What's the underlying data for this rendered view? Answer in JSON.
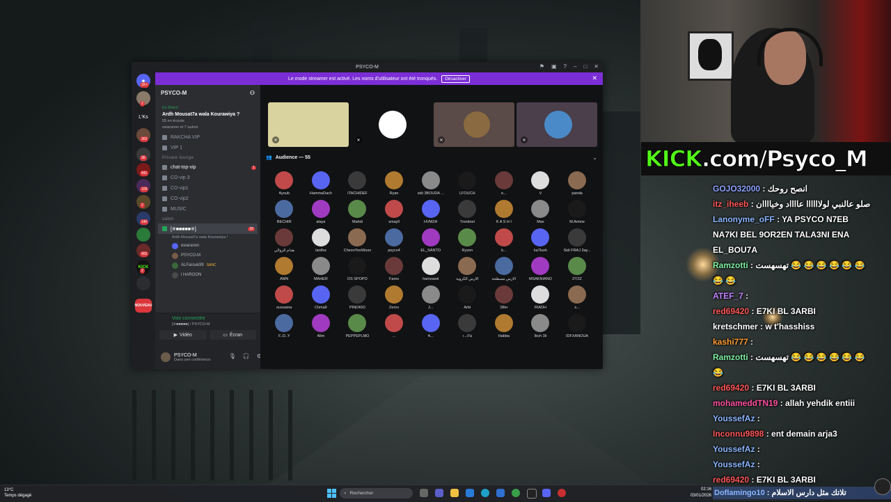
{
  "window": {
    "title": "PSYCO-M",
    "banner_text": "Le mode streamer est activé. Les noms d'utilisateur ont été tronqués.",
    "banner_button": "Désactiver"
  },
  "servers": {
    "lks_label": "L'Ks",
    "badges": [
      "1K+",
      "2",
      "362",
      "36",
      "441",
      "109",
      "2",
      "140",
      "403",
      "2"
    ],
    "kick_label": "KICK",
    "nouveau_label": "NOUVEAU"
  },
  "sidebar": {
    "server_name": "PSYCO-M",
    "live_tag": "En Direct",
    "live_title": "Ardh Mousat7a wala Kourawiya ?",
    "live_listen": "55 en écoute",
    "live_users": "ewaranon et 7 autres",
    "channels": [
      {
        "label": "RAKCHA VIP"
      },
      {
        "label": "VIP 1"
      }
    ],
    "cat_private": "Private lounge",
    "private_channels": [
      {
        "label": "chat-top-vip",
        "badge": "1"
      },
      {
        "label": "CO-vip 3"
      },
      {
        "label": "CO-vip1"
      },
      {
        "label": "CO-vip2"
      },
      {
        "label": "MUSIC"
      }
    ],
    "cat_salon": "salon",
    "active_stage": {
      "label": "[※■■■■■※]",
      "sub": "Ardh Mousat7a wala Kourawiya !",
      "badge": "26"
    },
    "stage_users": [
      "ewaranon",
      "PSYCO-M",
      "ALFarouk99",
      "l HAROON"
    ],
    "stage_user_tag": "SANC",
    "voice_status": "Voix connectée",
    "voice_sub": "[※■■■■■] / PSYCO-M",
    "video_label": "Vidéo",
    "screen_label": "Écran",
    "user_name": "PSYCO-M",
    "user_status": "Dans une conférence"
  },
  "stage": {
    "audience_label": "Audience — 55",
    "audience": [
      "Ayoub",
      "HammaDach",
      "ITACHIDEF",
      "Ryan",
      "sidi 3BOUDA ...",
      "LFOUCH",
      "e...",
      "V",
      "panda",
      "BECHIR",
      "alaya",
      "Mahdi",
      "smayll",
      "HVMZA",
      "Trontinet",
      "K A S H I",
      "Max",
      "M.Amine",
      "هدام الزوالي",
      "lardha",
      "CheonYeoWoon",
      "psyco4",
      "EL_SANTO",
      "Ryzen",
      "k...",
      "ka7lush",
      "Sidi FRAJ 3ay...",
      "AMN",
      "MAHER",
      "DS SPOPO",
      "Fares",
      "hamzawii",
      "الأرس الكروية",
      "الأرس مسطحة",
      "MSAKNIANO",
      "ZYZZ",
      "oussama",
      "Chma9",
      "PINOKIO",
      "Zerox",
      "J...",
      "Arbi",
      "Slfer",
      "RIADH",
      "s...",
      "F..D..Y",
      "Alim",
      "PEPPEPLMO",
      "...",
      "A...",
      "r...i7a",
      "Habba",
      "Ibch 3li",
      "IDFXANOUA"
    ]
  },
  "overlay": {
    "kick_logo": "KICK",
    "kick_rest": ".com/Psyco_M"
  },
  "chat": [
    {
      "user": "GOJO32000",
      "color": "#8aa0ff",
      "text": "انصح روحك"
    },
    {
      "user": "itz_iheeb",
      "color": "#ff5555",
      "text": "صلو عالنبي لولاااااا عااااد وخياااان"
    },
    {
      "user": "Lanonyme_oFF",
      "color": "#8ab4ff",
      "text": "YA PSYCO N7EB NA7KI BEL 9OR2EN TALA3NI ENA EL_BOU7A"
    },
    {
      "user": "Ramzotti",
      "color": "#7ef0a0",
      "text": "تهسهست 😂 😂 😂 😂 😂 😂 😂 😂"
    },
    {
      "user": "ATEF_7",
      "color": "#c080ff",
      "text": ""
    },
    {
      "user": "red69420",
      "color": "#ff5555",
      "text": "E7KI BL 3ARBI"
    },
    {
      "user": "kretschmer",
      "color": "#ffffff",
      "text": "w t'hasshiss"
    },
    {
      "user": "kashi777",
      "color": "#ff9a30",
      "text": ""
    },
    {
      "user": "Ramzotti",
      "color": "#7ef0a0",
      "text": "تهسهست 😂 😂 😂 😂 😂 😂 😂"
    },
    {
      "user": "red69420",
      "color": "#ff5555",
      "text": "E7KI BL 3ARBI"
    },
    {
      "user": "mohameddTN19",
      "color": "#ff4fa0",
      "text": "allah yehdik entiii"
    },
    {
      "user": "YoussefAz",
      "color": "#8ab4ff",
      "text": ""
    },
    {
      "user": "Inconnu9898",
      "color": "#ff5555",
      "text": "ent demain arja3"
    },
    {
      "user": "YoussefAz",
      "color": "#8ab4ff",
      "text": ""
    },
    {
      "user": "YoussefAz",
      "color": "#8ab4ff",
      "text": ""
    },
    {
      "user": "red69420",
      "color": "#ff5555",
      "text": "E7KI BL 3ARBI"
    }
  ],
  "chat_last": {
    "user": "Doflamingo10",
    "text": "تلاتك مثل دارس الاسلام"
  },
  "taskbar": {
    "temperature": "13°C",
    "weather": "Temps dégagé",
    "search_placeholder": "Rechercher",
    "time": "02:16",
    "date": "03/01/2026"
  }
}
